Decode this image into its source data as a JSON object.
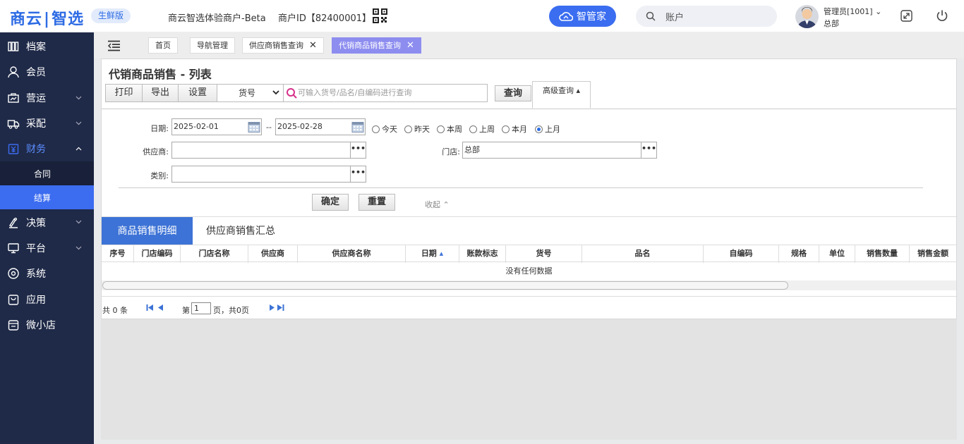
{
  "header": {
    "logo_left": "商云",
    "logo_right": "智选",
    "edition": "生鲜版",
    "merchant": "商云智选体验商户-Beta",
    "merchant_id": "商户ID【82400001】",
    "assistant_label": "智管家",
    "search_placeholder": "账户",
    "user_name": "管理员[1001]",
    "user_store": "总部"
  },
  "sidebar": {
    "items": [
      {
        "label": "档案",
        "icon": "archive-icon",
        "has_chevron": false
      },
      {
        "label": "会员",
        "icon": "user-icon",
        "has_chevron": false
      },
      {
        "label": "营运",
        "icon": "operations-icon",
        "has_chevron": true
      },
      {
        "label": "采配",
        "icon": "truck-icon",
        "has_chevron": true
      },
      {
        "label": "财务",
        "icon": "finance-icon",
        "has_chevron": true,
        "expanded": true
      }
    ],
    "sub_items": [
      {
        "label": "合同",
        "active": false
      },
      {
        "label": "结算",
        "active": true
      }
    ],
    "items_after": [
      {
        "label": "决策",
        "icon": "decision-icon",
        "has_chevron": true
      },
      {
        "label": "平台",
        "icon": "monitor-icon",
        "has_chevron": true
      },
      {
        "label": "系统",
        "icon": "system-icon",
        "has_chevron": false
      },
      {
        "label": "应用",
        "icon": "app-icon",
        "has_chevron": false
      },
      {
        "label": "微小店",
        "icon": "shop-icon",
        "has_chevron": false
      }
    ]
  },
  "tabs": [
    {
      "label": "首页",
      "closable": false,
      "active": false
    },
    {
      "label": "导航管理",
      "closable": false,
      "active": false
    },
    {
      "label": "供应商销售查询",
      "closable": true,
      "active": false
    },
    {
      "label": "代销商品销售查询",
      "closable": true,
      "active": true
    }
  ],
  "page": {
    "title": "代销商品销售 - 列表",
    "toolbar": {
      "print": "打印",
      "export": "导出",
      "settings": "设置",
      "field_select": "货号",
      "search_placeholder": "可输入货号/品名/自编码进行查询",
      "query": "查询",
      "advanced": "高级查询"
    },
    "filters": {
      "date_label": "日期:",
      "date_from": "2025-02-01",
      "date_sep": "--",
      "date_to": "2025-02-28",
      "supplier_label": "供应商:",
      "supplier_value": "",
      "store_label": "门店:",
      "store_value": "总部",
      "category_label": "类别:",
      "category_value": "",
      "radios": [
        {
          "label": "今天",
          "checked": false
        },
        {
          "label": "昨天",
          "checked": false
        },
        {
          "label": "本周",
          "checked": false
        },
        {
          "label": "上周",
          "checked": false
        },
        {
          "label": "本月",
          "checked": false
        },
        {
          "label": "上月",
          "checked": true
        }
      ],
      "confirm": "确定",
      "reset": "重置",
      "collapse": "收起"
    },
    "subtabs": [
      {
        "label": "商品销售明细",
        "active": true
      },
      {
        "label": "供应商销售汇总",
        "active": false
      }
    ],
    "grid": {
      "columns": [
        "序号",
        "门店编码",
        "门店名称",
        "供应商",
        "供应商名称",
        "日期",
        "账款标志",
        "货号",
        "品名",
        "自编码",
        "规格",
        "单位",
        "销售数量",
        "销售金额"
      ],
      "empty_text": "没有任何数据"
    },
    "pager": {
      "total": "共 0 条",
      "page_prefix": "第",
      "page_value": "1",
      "page_suffix": "页，共0页"
    }
  },
  "colors": {
    "brand": "#2d6be4",
    "sidebar_bg": "#1f2a48",
    "active_sub": "#3c6cf0",
    "active_tab": "#8d8df0",
    "active_subtab": "#3d73d6"
  }
}
